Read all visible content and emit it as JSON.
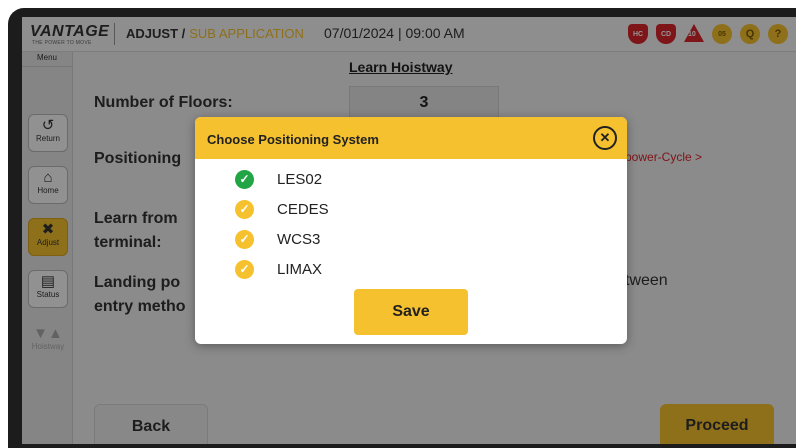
{
  "header": {
    "logo": "VANTAGE",
    "logo_tagline": "THE POWER TO MOVE",
    "module": "ADJUST /",
    "sub_module": "SUB APPLICATION",
    "datetime": "07/01/2024 | 09:00 AM",
    "status_icons": [
      {
        "name": "hc-alert-icon",
        "text": "HC"
      },
      {
        "name": "cd-alert-icon",
        "text": "CD"
      },
      {
        "name": "fault-count-icon",
        "text": "10"
      },
      {
        "name": "alarm-clock-icon",
        "text": "05"
      },
      {
        "name": "search-icon",
        "text": "Q"
      },
      {
        "name": "help-icon",
        "text": "?"
      }
    ]
  },
  "sidebar": {
    "menu_label": "Menu",
    "items": [
      {
        "label": "Return",
        "icon": "return-icon",
        "state": "normal"
      },
      {
        "label": "Home",
        "icon": "home-icon",
        "state": "normal"
      },
      {
        "label": "Adjust",
        "icon": "tools-icon",
        "state": "active"
      },
      {
        "label": "Status",
        "icon": "monitor-icon",
        "state": "normal"
      },
      {
        "label": "Hoistway",
        "icon": "hoistway-icon",
        "state": "disabled"
      }
    ]
  },
  "main": {
    "page_title": "Learn Hoistway",
    "number_of_floors_label": "Number of Floors:",
    "number_of_floors_value": "3",
    "positioning_label": "Positioning",
    "power_cycle_note": "power-Cycle >",
    "learn_from_label": "Learn from",
    "terminal_label": "terminal:",
    "landing_label": "Landing po",
    "entry_method_label": "entry metho",
    "between_text": "tween",
    "back_button": "Back",
    "proceed_button": "Proceed"
  },
  "modal": {
    "title": "Choose Positioning System",
    "options": [
      {
        "label": "LES02",
        "selected": true
      },
      {
        "label": "CEDES",
        "selected": false
      },
      {
        "label": "WCS3",
        "selected": false
      },
      {
        "label": "LIMAX",
        "selected": false
      }
    ],
    "save_button": "Save"
  },
  "colors": {
    "accent": "#f5c12e",
    "selected_check": "#22a544",
    "alert_red": "#d9262c"
  }
}
